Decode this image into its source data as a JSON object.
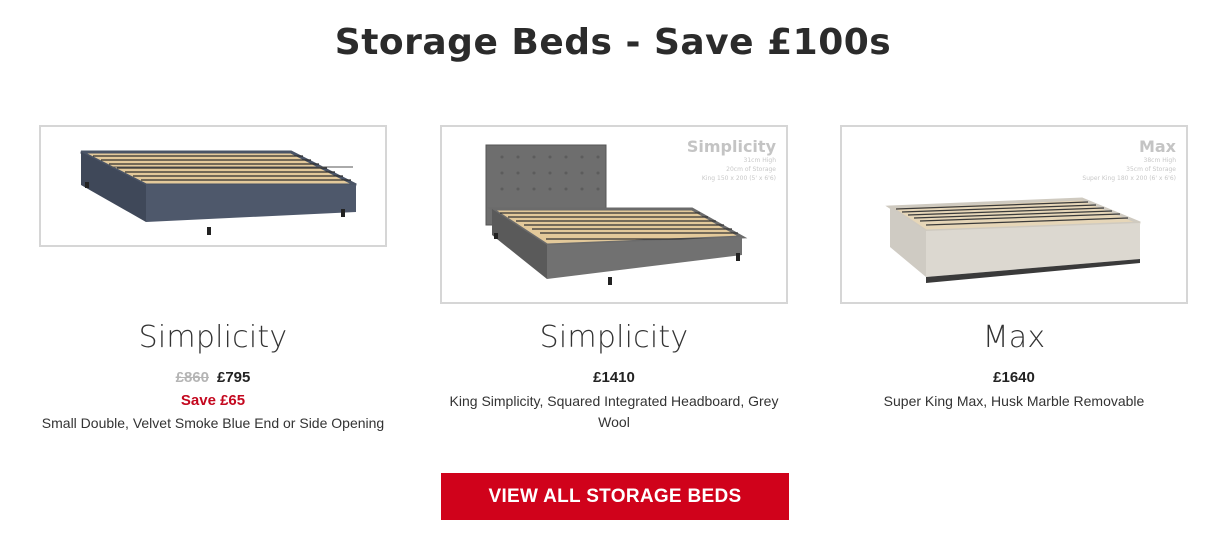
{
  "section": {
    "title": "Storage Beds - Save £100s",
    "cta_label": "VIEW ALL STORAGE BEDS"
  },
  "products": [
    {
      "name": "Simplicity",
      "was_price": "£860",
      "price": "£795",
      "save": "Save £65",
      "description": "Small Double, Velvet Smoke Blue End or Side Opening",
      "color": "#4a5466"
    },
    {
      "name": "Simplicity",
      "price": "£1410",
      "description": "King Simplicity, Squared Integrated Headboard, Grey Wool",
      "overlay": {
        "name": "Simplicity",
        "line1": "31cm High",
        "line2": "20cm of Storage",
        "line3": "King 150 x 200 (5' x 6'6)"
      },
      "color": "#6b6b6b"
    },
    {
      "name": "Max",
      "price": "£1640",
      "description": "Super King Max, Husk Marble Removable",
      "overlay": {
        "name": "Max",
        "line1": "38cm High",
        "line2": "35cm of Storage",
        "line3": "Super King 180 x 200 (6' x 6'6)"
      },
      "color": "#d8d4cc"
    }
  ],
  "colors": {
    "accent": "#d0021b",
    "save_text": "#c4081f"
  }
}
